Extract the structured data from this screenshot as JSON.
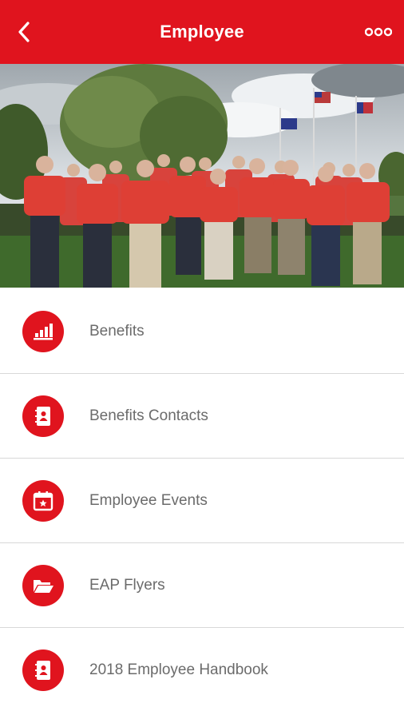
{
  "header": {
    "title": "Employee",
    "back_icon": "chevron-left-icon",
    "more_icon": "more-dots-icon"
  },
  "hero": {
    "image": "group-photo"
  },
  "menu": {
    "items": [
      {
        "label": "Benefits",
        "icon": "chart-bars-icon"
      },
      {
        "label": "Benefits Contacts",
        "icon": "contact-book-icon"
      },
      {
        "label": "Employee Events",
        "icon": "calendar-star-icon"
      },
      {
        "label": "EAP Flyers",
        "icon": "folder-open-icon"
      },
      {
        "label": "2018 Employee Handbook",
        "icon": "contact-book-icon"
      }
    ]
  },
  "colors": {
    "brand": "#e0141e",
    "label_text": "#6b6b6b",
    "divider": "#d8d8d8"
  }
}
